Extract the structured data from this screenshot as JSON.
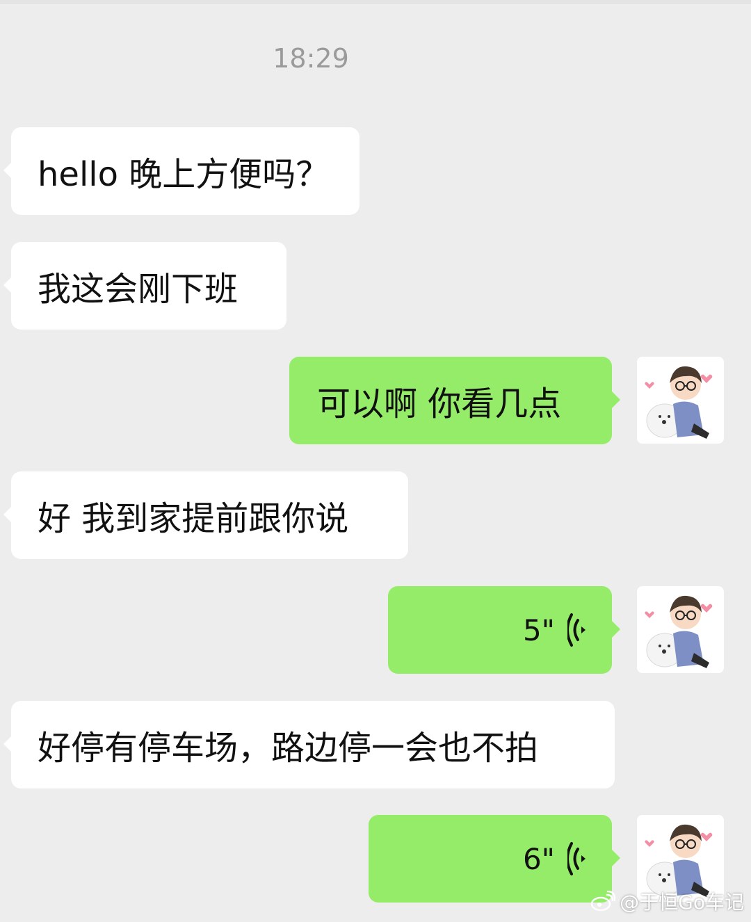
{
  "chat": {
    "timestamp": "18:29",
    "messages": [
      {
        "side": "in",
        "type": "text",
        "text": "hello 晚上方便吗？"
      },
      {
        "side": "in",
        "type": "text",
        "text": "我这会刚下班"
      },
      {
        "side": "out",
        "type": "text",
        "text": "可以啊 你看几点"
      },
      {
        "side": "in",
        "type": "text",
        "text": "好 我到家提前跟你说"
      },
      {
        "side": "out",
        "type": "voice",
        "duration": "5\""
      },
      {
        "side": "in",
        "type": "text",
        "text": "好停有停车场，路边停一会也不拍"
      },
      {
        "side": "out",
        "type": "voice",
        "duration": "6\""
      }
    ]
  },
  "avatar": {
    "description_icon": "anime-boy-with-white-dog-avatar"
  },
  "watermark": {
    "text": "@于恒Go车记",
    "icon": "weibo-icon"
  },
  "colors": {
    "background": "#ededed",
    "incoming_bubble": "#ffffff",
    "outgoing_bubble": "#95ec69",
    "timestamp": "#9a9a9a"
  }
}
